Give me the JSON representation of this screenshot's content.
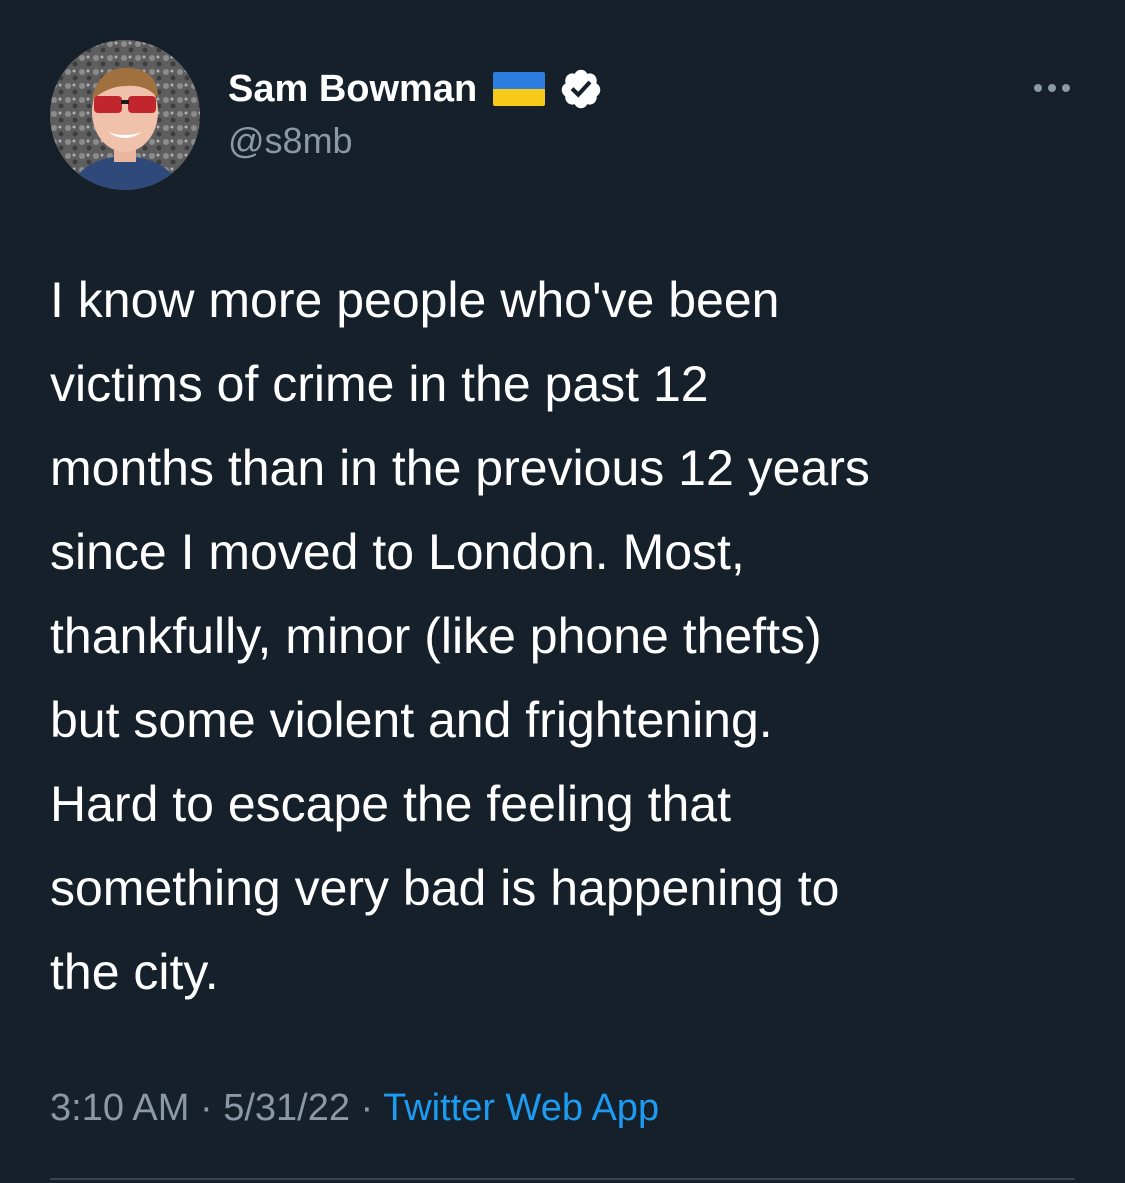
{
  "author": {
    "display_name": "Sam Bowman",
    "handle": "@s8mb",
    "flag_icon": "ukraine-flag-icon",
    "verified_icon": "verified-badge-icon"
  },
  "more_icon": "more-options-icon",
  "tweet": {
    "lines": [
      "I know more people who've been",
      "victims of crime in the past 12",
      "months than in the previous 12 years",
      "since I moved to London. Most,",
      "thankfully, minor (like phone thefts)",
      "but some violent and frightening.",
      "Hard to escape the feeling that",
      "something very bad is happening to",
      "the city."
    ]
  },
  "meta": {
    "time": "3:10 AM",
    "separator": " · ",
    "date": "5/31/22",
    "source": "Twitter Web App"
  },
  "colors": {
    "background": "#15202b",
    "text": "#ffffff",
    "secondary": "#8b98a5",
    "link": "#1d9bf0"
  }
}
